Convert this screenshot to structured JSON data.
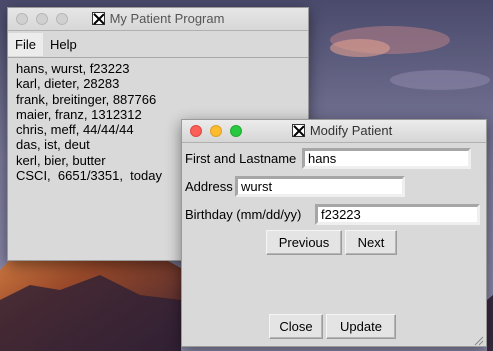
{
  "main_window": {
    "title": "My Patient Program",
    "menu": [
      {
        "label": "File"
      },
      {
        "label": "Help"
      }
    ],
    "patients": [
      "hans, wurst, f23223",
      "karl, dieter, 28283",
      "frank, breitinger, 887766",
      "maier, franz, 1312312",
      "chris, meff, 44/44/44",
      "das, ist, deut",
      "kerl, bier, butter",
      "CSCI,  6651/3351,  today"
    ]
  },
  "modify_window": {
    "title": "Modify Patient",
    "name_label": "First and Lastname",
    "name_value": "hans",
    "address_label": "Address",
    "address_value": "wurst",
    "birthday_label": "Birthday (mm/dd/yy)",
    "birthday_value": "f23223",
    "previous_label": "Previous",
    "next_label": "Next",
    "close_label": "Close",
    "update_label": "Update"
  },
  "icons": {
    "app_icon": "x11-icon",
    "traffic_lights": [
      "close",
      "minimize",
      "zoom"
    ]
  },
  "colors": {
    "close_red": "#fc5f57",
    "minimize_yellow": "#fdbc2e",
    "zoom_green": "#28c840",
    "window_bg": "#d9d9d9"
  }
}
